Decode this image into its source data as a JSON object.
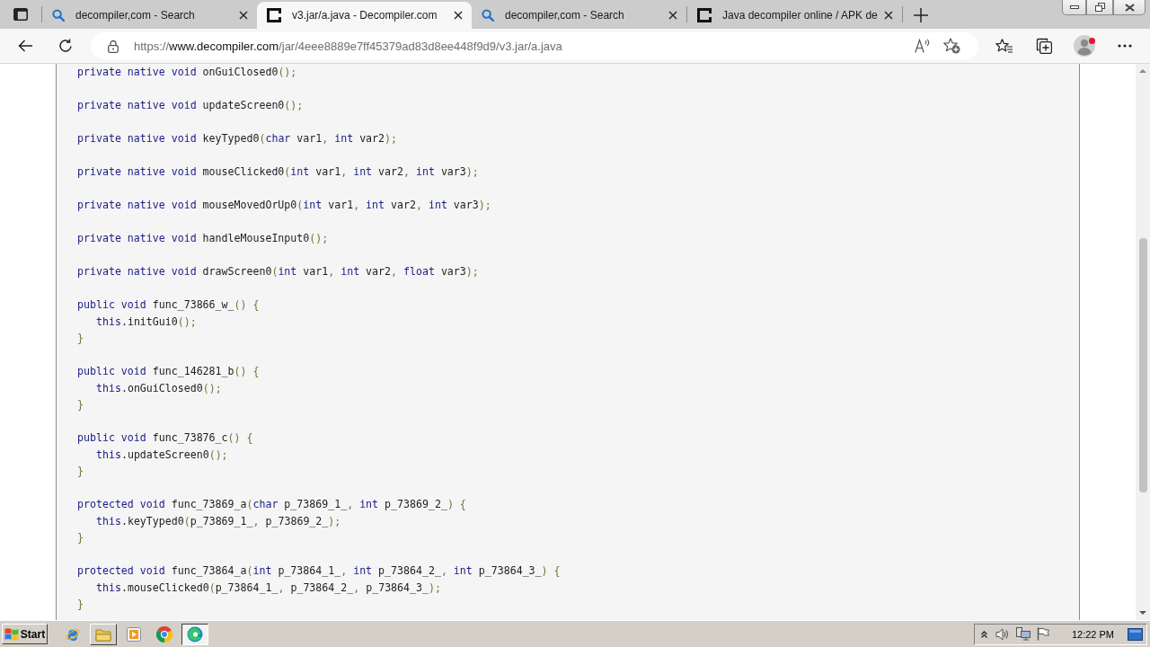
{
  "tab_strip": {
    "tabs": [
      {
        "kind": "search",
        "title": "decompiler,com - Search",
        "selected": false
      },
      {
        "kind": "page",
        "title": "v3.jar/a.java - Decompiler.com",
        "selected": true
      },
      {
        "kind": "search",
        "title": "decompiler,com - Search",
        "selected": false
      },
      {
        "kind": "page",
        "title": "Java decompiler online / APK de",
        "selected": false
      }
    ]
  },
  "toolbar": {
    "url": {
      "scheme": "https://",
      "host": "www.decompiler.com",
      "path": "/jar/4eee8889e7ff45379ad83d8ee448f9d9/v3.jar/a.java"
    },
    "profile": {
      "alert": true
    }
  },
  "code": [
    {
      "opening": [
        {
          "text": "private native void ",
          "kind": "keyword"
        },
        {
          "text": "onGuiClosed0",
          "kind": "name"
        },
        {
          "text": "();",
          "kind": "punct"
        }
      ]
    },
    {
      "opening": [
        {
          "text": "private native void ",
          "kind": "keyword"
        },
        {
          "text": "updateScreen0",
          "kind": "name"
        },
        {
          "text": "();",
          "kind": "punct"
        }
      ]
    },
    {
      "opening": [
        {
          "text": "private native void ",
          "kind": "keyword"
        },
        {
          "text": "keyTyped0",
          "kind": "name"
        },
        {
          "text": "(",
          "kind": "punct"
        },
        {
          "text": "char ",
          "kind": "keyword"
        },
        {
          "text": "var1",
          "kind": "name"
        },
        {
          "text": ", ",
          "kind": "punct"
        },
        {
          "text": "int ",
          "kind": "keyword"
        },
        {
          "text": "var2",
          "kind": "name"
        },
        {
          "text": ");",
          "kind": "punct"
        }
      ]
    },
    {
      "opening": [
        {
          "text": "private native void ",
          "kind": "keyword"
        },
        {
          "text": "mouseClicked0",
          "kind": "name"
        },
        {
          "text": "(",
          "kind": "punct"
        },
        {
          "text": "int ",
          "kind": "keyword"
        },
        {
          "text": "var1",
          "kind": "name"
        },
        {
          "text": ", ",
          "kind": "punct"
        },
        {
          "text": "int ",
          "kind": "keyword"
        },
        {
          "text": "var2",
          "kind": "name"
        },
        {
          "text": ", ",
          "kind": "punct"
        },
        {
          "text": "int ",
          "kind": "keyword"
        },
        {
          "text": "var3",
          "kind": "name"
        },
        {
          "text": ");",
          "kind": "punct"
        }
      ]
    },
    {
      "opening": [
        {
          "text": "private native void ",
          "kind": "keyword"
        },
        {
          "text": "mouseMovedOrUp0",
          "kind": "name"
        },
        {
          "text": "(",
          "kind": "punct"
        },
        {
          "text": "int ",
          "kind": "keyword"
        },
        {
          "text": "var1",
          "kind": "name"
        },
        {
          "text": ", ",
          "kind": "punct"
        },
        {
          "text": "int ",
          "kind": "keyword"
        },
        {
          "text": "var2",
          "kind": "name"
        },
        {
          "text": ", ",
          "kind": "punct"
        },
        {
          "text": "int ",
          "kind": "keyword"
        },
        {
          "text": "var3",
          "kind": "name"
        },
        {
          "text": ");",
          "kind": "punct"
        }
      ]
    },
    {
      "opening": [
        {
          "text": "private native void ",
          "kind": "keyword"
        },
        {
          "text": "handleMouseInput0",
          "kind": "name"
        },
        {
          "text": "();",
          "kind": "punct"
        }
      ]
    },
    {
      "opening": [
        {
          "text": "private native void ",
          "kind": "keyword"
        },
        {
          "text": "drawScreen0",
          "kind": "name"
        },
        {
          "text": "(",
          "kind": "punct"
        },
        {
          "text": "int ",
          "kind": "keyword"
        },
        {
          "text": "var1",
          "kind": "name"
        },
        {
          "text": ", ",
          "kind": "punct"
        },
        {
          "text": "int ",
          "kind": "keyword"
        },
        {
          "text": "var2",
          "kind": "name"
        },
        {
          "text": ", ",
          "kind": "punct"
        },
        {
          "text": "float ",
          "kind": "keyword"
        },
        {
          "text": "var3",
          "kind": "name"
        },
        {
          "text": ");",
          "kind": "punct"
        }
      ]
    },
    {
      "opening": [
        {
          "text": "public void ",
          "kind": "keyword"
        },
        {
          "text": "func_73866_w_",
          "kind": "name"
        },
        {
          "text": "() {",
          "kind": "punct"
        }
      ],
      "body": [
        [
          {
            "text": "this",
            "kind": "keyword"
          },
          {
            "text": ".initGui0",
            "kind": "name"
          },
          {
            "text": "();",
            "kind": "punct"
          }
        ]
      ],
      "closing": [
        {
          "text": "}",
          "kind": "punct"
        }
      ]
    },
    {
      "opening": [
        {
          "text": "public void ",
          "kind": "keyword"
        },
        {
          "text": "func_146281_b",
          "kind": "name"
        },
        {
          "text": "() {",
          "kind": "punct"
        }
      ],
      "body": [
        [
          {
            "text": "this",
            "kind": "keyword"
          },
          {
            "text": ".onGuiClosed0",
            "kind": "name"
          },
          {
            "text": "();",
            "kind": "punct"
          }
        ]
      ],
      "closing": [
        {
          "text": "}",
          "kind": "punct"
        }
      ]
    },
    {
      "opening": [
        {
          "text": "public void ",
          "kind": "keyword"
        },
        {
          "text": "func_73876_c",
          "kind": "name"
        },
        {
          "text": "() {",
          "kind": "punct"
        }
      ],
      "body": [
        [
          {
            "text": "this",
            "kind": "keyword"
          },
          {
            "text": ".updateScreen0",
            "kind": "name"
          },
          {
            "text": "();",
            "kind": "punct"
          }
        ]
      ],
      "closing": [
        {
          "text": "}",
          "kind": "punct"
        }
      ]
    },
    {
      "opening": [
        {
          "text": "protected void ",
          "kind": "keyword"
        },
        {
          "text": "func_73869_a",
          "kind": "name"
        },
        {
          "text": "(",
          "kind": "punct"
        },
        {
          "text": "char ",
          "kind": "keyword"
        },
        {
          "text": "p_73869_1_",
          "kind": "name"
        },
        {
          "text": ", ",
          "kind": "punct"
        },
        {
          "text": "int ",
          "kind": "keyword"
        },
        {
          "text": "p_73869_2_",
          "kind": "name"
        },
        {
          "text": ") {",
          "kind": "punct"
        }
      ],
      "body": [
        [
          {
            "text": "this",
            "kind": "keyword"
          },
          {
            "text": ".keyTyped0",
            "kind": "name"
          },
          {
            "text": "(",
            "kind": "punct"
          },
          {
            "text": "p_73869_1_",
            "kind": "name"
          },
          {
            "text": ", ",
            "kind": "punct"
          },
          {
            "text": "p_73869_2_",
            "kind": "name"
          },
          {
            "text": ");",
            "kind": "punct"
          }
        ]
      ],
      "closing": [
        {
          "text": "}",
          "kind": "punct"
        }
      ]
    },
    {
      "opening": [
        {
          "text": "protected void ",
          "kind": "keyword"
        },
        {
          "text": "func_73864_a",
          "kind": "name"
        },
        {
          "text": "(",
          "kind": "punct"
        },
        {
          "text": "int ",
          "kind": "keyword"
        },
        {
          "text": "p_73864_1_",
          "kind": "name"
        },
        {
          "text": ", ",
          "kind": "punct"
        },
        {
          "text": "int ",
          "kind": "keyword"
        },
        {
          "text": "p_73864_2_",
          "kind": "name"
        },
        {
          "text": ", ",
          "kind": "punct"
        },
        {
          "text": "int ",
          "kind": "keyword"
        },
        {
          "text": "p_73864_3_",
          "kind": "name"
        },
        {
          "text": ") {",
          "kind": "punct"
        }
      ],
      "body": [
        [
          {
            "text": "this",
            "kind": "keyword"
          },
          {
            "text": ".mouseClicked0",
            "kind": "name"
          },
          {
            "text": "(",
            "kind": "punct"
          },
          {
            "text": "p_73864_1_",
            "kind": "name"
          },
          {
            "text": ", ",
            "kind": "punct"
          },
          {
            "text": "p_73864_2_",
            "kind": "name"
          },
          {
            "text": ", ",
            "kind": "punct"
          },
          {
            "text": "p_73864_3_",
            "kind": "name"
          },
          {
            "text": ");",
            "kind": "punct"
          }
        ]
      ],
      "closing": [
        {
          "text": "}",
          "kind": "punct"
        }
      ]
    }
  ],
  "taskbar": {
    "start_label": "Start",
    "apps": [
      {
        "kind": "ie",
        "open": false,
        "selected": false
      },
      {
        "kind": "folder",
        "open": true,
        "selected": false
      },
      {
        "kind": "media",
        "open": false,
        "selected": false
      },
      {
        "kind": "chrome",
        "open": false,
        "selected": false
      },
      {
        "kind": "edge",
        "open": true,
        "selected": true
      }
    ],
    "clock": "12:22 PM"
  }
}
